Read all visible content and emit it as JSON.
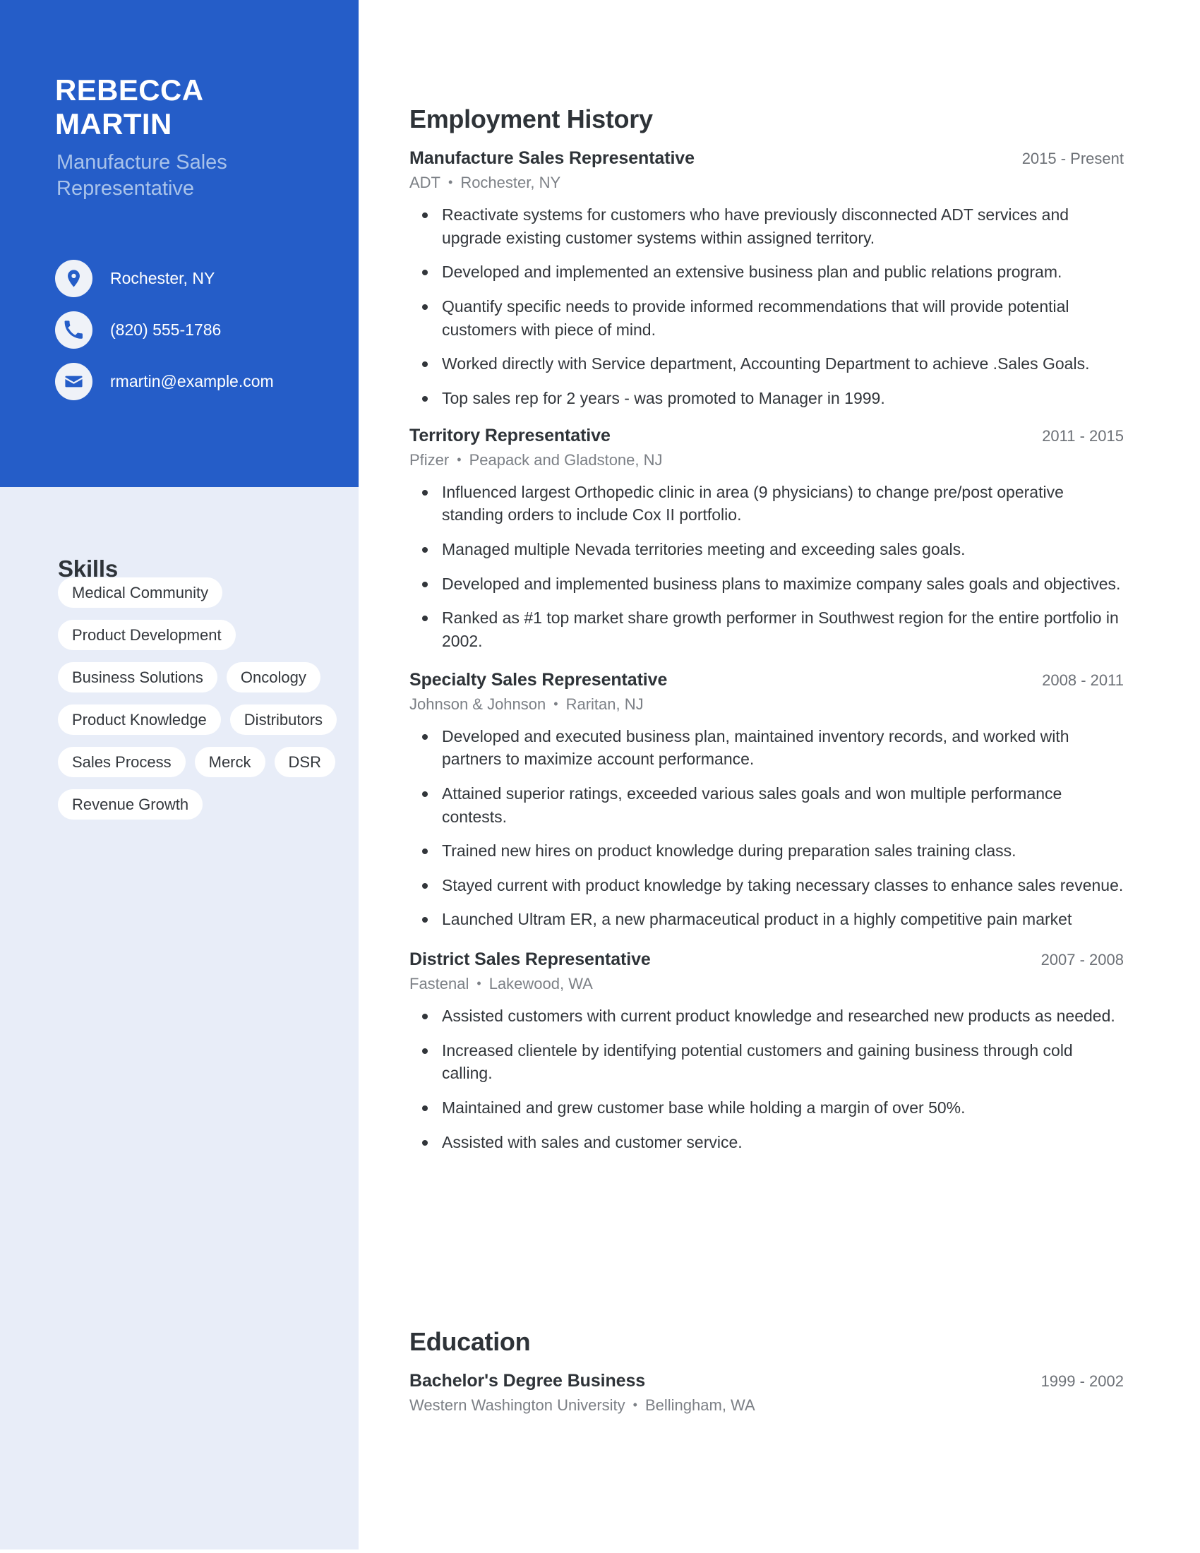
{
  "profile": {
    "first_name": "REBECCA",
    "last_name": "MARTIN",
    "title_line1": "Manufacture Sales",
    "title_line2": "Representative",
    "location": "Rochester, NY",
    "phone": "(820) 555-1786",
    "email": "rmartin@example.com",
    "location_icon": "map-pin-icon",
    "phone_icon": "phone-icon",
    "email_icon": "envelope-icon"
  },
  "colors": {
    "accent_blue": "#255DC8",
    "sidebar_bg": "#E8EDF8",
    "subtitle_blue": "#A9C3EA",
    "heading_dark": "#2E3338",
    "body_text": "#32363B",
    "muted_text": "#7C8086"
  },
  "skills": {
    "heading": "Skills",
    "items": [
      "Medical Community",
      "Product Development",
      "Business Solutions",
      "Oncology",
      "Product Knowledge",
      "Distributors",
      "Sales Process",
      "Merck",
      "DSR",
      "Revenue Growth"
    ]
  },
  "employment": {
    "heading": "Employment History",
    "entries": [
      {
        "title": "Manufacture Sales Representative",
        "dates": "2015 - Present",
        "company": "ADT",
        "location": "Rochester, NY",
        "bullets": [
          "Reactivate systems for customers who have previously disconnected ADT services and upgrade existing customer systems within assigned territory.",
          "Developed and implemented an extensive business plan and public relations program.",
          "Quantify specific needs to provide informed recommendations that will provide potential customers with piece of mind.",
          "Worked directly with Service department, Accounting Department to achieve .Sales Goals.",
          "Top sales rep for 2 years - was promoted to Manager in 1999."
        ]
      },
      {
        "title": "Territory Representative",
        "dates": "2011 - 2015",
        "company": "Pfizer",
        "location": "Peapack and Gladstone, NJ",
        "bullets": [
          "Influenced largest Orthopedic clinic in area (9 physicians) to change pre/post operative standing orders to include Cox II portfolio.",
          "Managed multiple Nevada territories meeting and exceeding sales goals.",
          "Developed and implemented business plans to maximize company sales goals and objectives.",
          "Ranked as #1 top market share growth performer in Southwest region for the entire portfolio in 2002."
        ]
      },
      {
        "title": "Specialty Sales Representative",
        "dates": "2008 - 2011",
        "company": "Johnson & Johnson",
        "location": "Raritan, NJ",
        "bullets": [
          "Developed and executed business plan, maintained inventory records, and worked with partners to maximize account performance.",
          "Attained superior ratings, exceeded various sales goals and won multiple performance contests.",
          "Trained new hires on product knowledge during preparation sales training class.",
          "Stayed current with product knowledge by taking necessary classes to enhance sales revenue.",
          "Launched Ultram ER, a new pharmaceutical product in a highly competitive pain market"
        ]
      },
      {
        "title": "District Sales Representative",
        "dates": "2007 - 2008",
        "company": "Fastenal",
        "location": "Lakewood, WA",
        "bullets": [
          "Assisted customers with current product knowledge and researched new products as needed.",
          "Increased clientele by identifying potential customers and gaining business through cold calling.",
          "Maintained and grew customer base while holding a margin of over 50%.",
          "Assisted with sales and customer service."
        ]
      }
    ]
  },
  "education": {
    "heading": "Education",
    "entries": [
      {
        "title": "Bachelor's Degree Business",
        "dates": "1999 - 2002",
        "company": "Western Washington University",
        "location": "Bellingham, WA",
        "bullets": []
      }
    ]
  },
  "separator": "•"
}
